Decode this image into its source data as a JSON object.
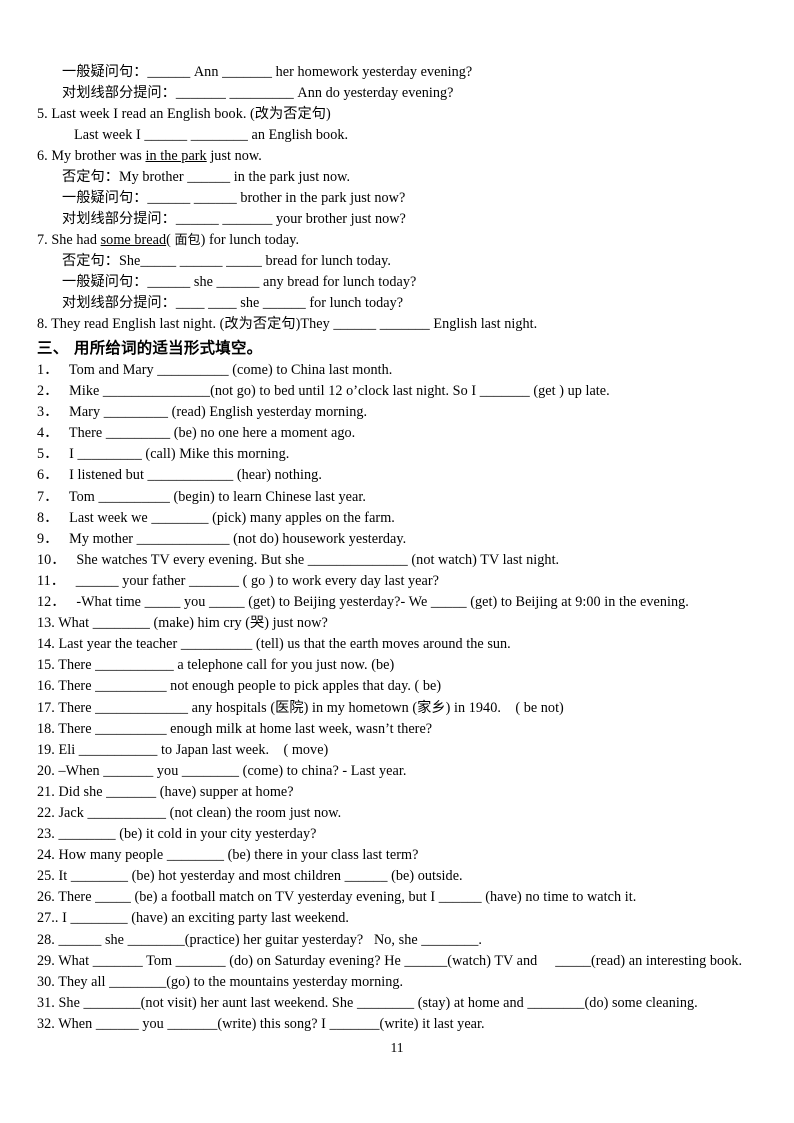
{
  "document": {
    "page_number": "11",
    "text_color": "#000000",
    "background_color": "#ffffff"
  },
  "section_two_tail": {
    "lines": [
      {
        "indent": "sub",
        "text": "一般疑问句：______ Ann _______ her homework yesterday evening?"
      },
      {
        "indent": "sub",
        "text": "对划线部分提问：_______ _________ Ann do yesterday evening?"
      },
      {
        "indent": "none",
        "text": "5. Last week I read an English book. (改为否定句)"
      },
      {
        "indent": "ind2",
        "text": "Last week I ______ ________ an English book."
      },
      {
        "indent": "none",
        "text": "6. My brother was in the park just now.",
        "underline": "in the park"
      },
      {
        "indent": "sub",
        "text": "否定句：My brother ______ in the park just now."
      },
      {
        "indent": "sub",
        "text": "一般疑问句：______ ______ brother in the park just now?"
      },
      {
        "indent": "sub",
        "text": "对划线部分提问：______ _______ your brother just now?"
      },
      {
        "indent": "none",
        "text": "7. She had some bread( 面包) for lunch today.",
        "underline": "some bread"
      },
      {
        "indent": "sub",
        "text": "否定句：She_____ ______ _____ bread for lunch today."
      },
      {
        "indent": "sub",
        "text": "一般疑问句：______ she ______ any bread for lunch today?"
      },
      {
        "indent": "sub",
        "text": "对划线部分提问：____ ____ she ______ for lunch today?"
      },
      {
        "indent": "none",
        "text": "8. They read English last night. (改为否定句)They ______ _______ English last night."
      }
    ]
  },
  "section_three": {
    "heading": "三、  用所给词的适当形式填空。",
    "items": [
      "1．   Tom and Mary __________ (come) to China last month.",
      "2．   Mike _______________(not go) to bed until 12 o’clock last night. So I _______ (get ) up late.",
      "3．   Mary _________ (read) English yesterday morning.",
      "4．   There _________ (be) no one here a moment ago.",
      "5．   I _________ (call) Mike this morning.",
      "6．   I listened but ____________ (hear) nothing.",
      "7．   Tom __________ (begin) to learn Chinese last year.",
      "8．   Last week we ________ (pick) many apples on the farm.",
      "9．   My mother _____________ (not do) housework yesterday.",
      "10．   She watches TV every evening. But she ______________ (not watch) TV last night.",
      "11．   ______ your father _______ ( go ) to work every day last year?",
      "12．   -What time _____ you _____ (get) to Beijing yesterday?- We _____ (get) to Beijing at 9:00 in the evening.",
      "13. What ________ (make) him cry (哭) just now?",
      "14. Last year the teacher __________ (tell) us that the earth moves around the sun.",
      "15. There ___________ a telephone call for you just now. (be)",
      "16. There __________ not enough people to pick apples that day. ( be)",
      "17. There _____________ any hospitals (医院) in my hometown (家乡) in 1940.    ( be not)",
      "18. There __________ enough milk at home last week, wasn’t there?",
      "19. Eli ___________ to Japan last week.    ( move)",
      "20. –When _______ you ________ (come) to china? - Last year.",
      "21. Did she _______ (have) supper at home?",
      "22. Jack ___________ (not clean) the room just now.",
      "23. ________ (be) it cold in your city yesterday?",
      "24. How many people ________ (be) there in your class last term?",
      "25. It ________ (be) hot yesterday and most children ______ (be) outside.",
      "26. There _____ (be) a football match on TV yesterday evening, but I ______ (have) no time to watch it.",
      "27.. I ________ (have) an exciting party last weekend.",
      "28. ______ she ________(practice) her guitar yesterday?   No, she ________.",
      "29. What _______ Tom _______ (do) on Saturday evening? He ______(watch) TV and     _____(read) an interesting book.",
      "30. They all ________(go) to the mountains yesterday morning.",
      "31. She ________(not visit) her aunt last weekend. She ________ (stay) at home and ________(do) some cleaning.",
      "32. When ______ you _______(write) this song? I _______(write) it last year."
    ]
  }
}
